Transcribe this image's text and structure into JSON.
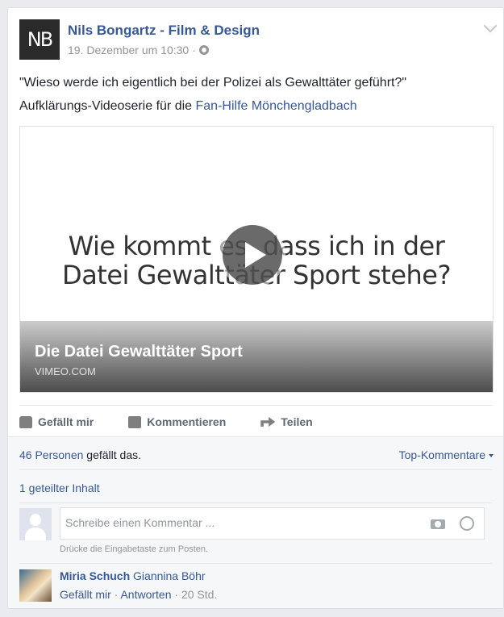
{
  "post": {
    "author_initials": "NB",
    "author": "Nils Bongartz - Film & Design",
    "timestamp": "19. Dezember um 10:30",
    "meta_sep": "·",
    "text_line1": "\"Wieso werde ich eigentlich bei der Polizei als Gewalttäter geführt?\"",
    "text_line2_prefix": "Aufklärungs-Videoserie für die ",
    "text_line2_link": "Fan-Hilfe Mönchengladbach"
  },
  "video": {
    "thumb_line1": "Wie kommt es, dass ich in der",
    "thumb_line2": "Datei Gewalttäter Sport stehe?",
    "title": "Die Datei Gewalttäter Sport",
    "domain": "VIMEO.COM"
  },
  "actions": {
    "like": "Gefällt mir",
    "comment": "Kommentieren",
    "share": "Teilen"
  },
  "engagement": {
    "likes_link": "46 Personen",
    "likes_suffix": " gefällt das.",
    "top_comments": "Top-Kommentare",
    "shares": "1 geteilter Inhalt"
  },
  "comment_box": {
    "placeholder": "Schreibe einen Kommentar ...",
    "hint": "Drücke die Eingabetaste zum Posten."
  },
  "reply": {
    "author": "Miria Schuch",
    "tagged": "Giannina Böhr",
    "like": "Gefällt mir",
    "sep": " · ",
    "reply": "Antworten",
    "time": "20 Std."
  }
}
